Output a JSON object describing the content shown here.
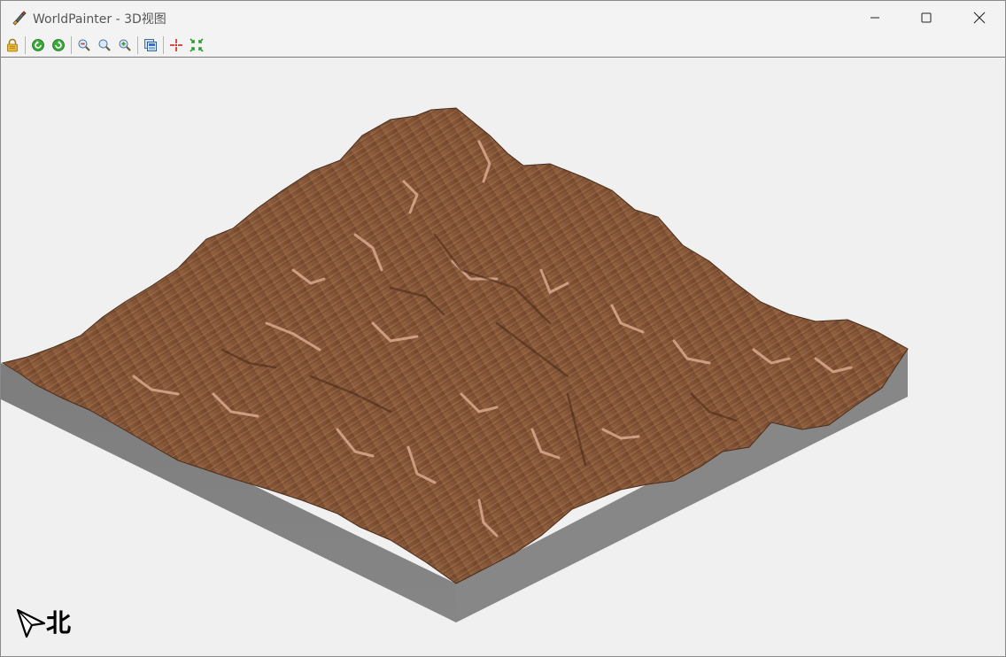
{
  "window": {
    "title": "WorldPainter - 3D视图",
    "controls": {
      "minimize": "minimize-icon",
      "maximize": "maximize-icon",
      "close": "close-icon"
    }
  },
  "toolbar": {
    "buttons": [
      {
        "name": "lock-icon",
        "color": "#d4a017"
      },
      {
        "name": "rotate-left-icon",
        "color": "#2e9b2e"
      },
      {
        "name": "rotate-right-icon",
        "color": "#2e9b2e"
      },
      {
        "name": "zoom-out-icon",
        "color": "#c23b3b"
      },
      {
        "name": "zoom-reset-icon",
        "color": "#3b6fc2"
      },
      {
        "name": "zoom-in-icon",
        "color": "#2e9b2e"
      },
      {
        "name": "export-image-icon",
        "color": "#3b6fc2"
      },
      {
        "name": "center-view-icon",
        "color": "#d22222"
      },
      {
        "name": "fit-view-icon",
        "color": "#2e9b2e"
      }
    ]
  },
  "viewport": {
    "background": "#f0f0f0",
    "terrain_color": "#8a5a36",
    "terrain_side_color": "#808080",
    "compass": {
      "icon": "north-arrow-icon",
      "label": "北"
    }
  }
}
